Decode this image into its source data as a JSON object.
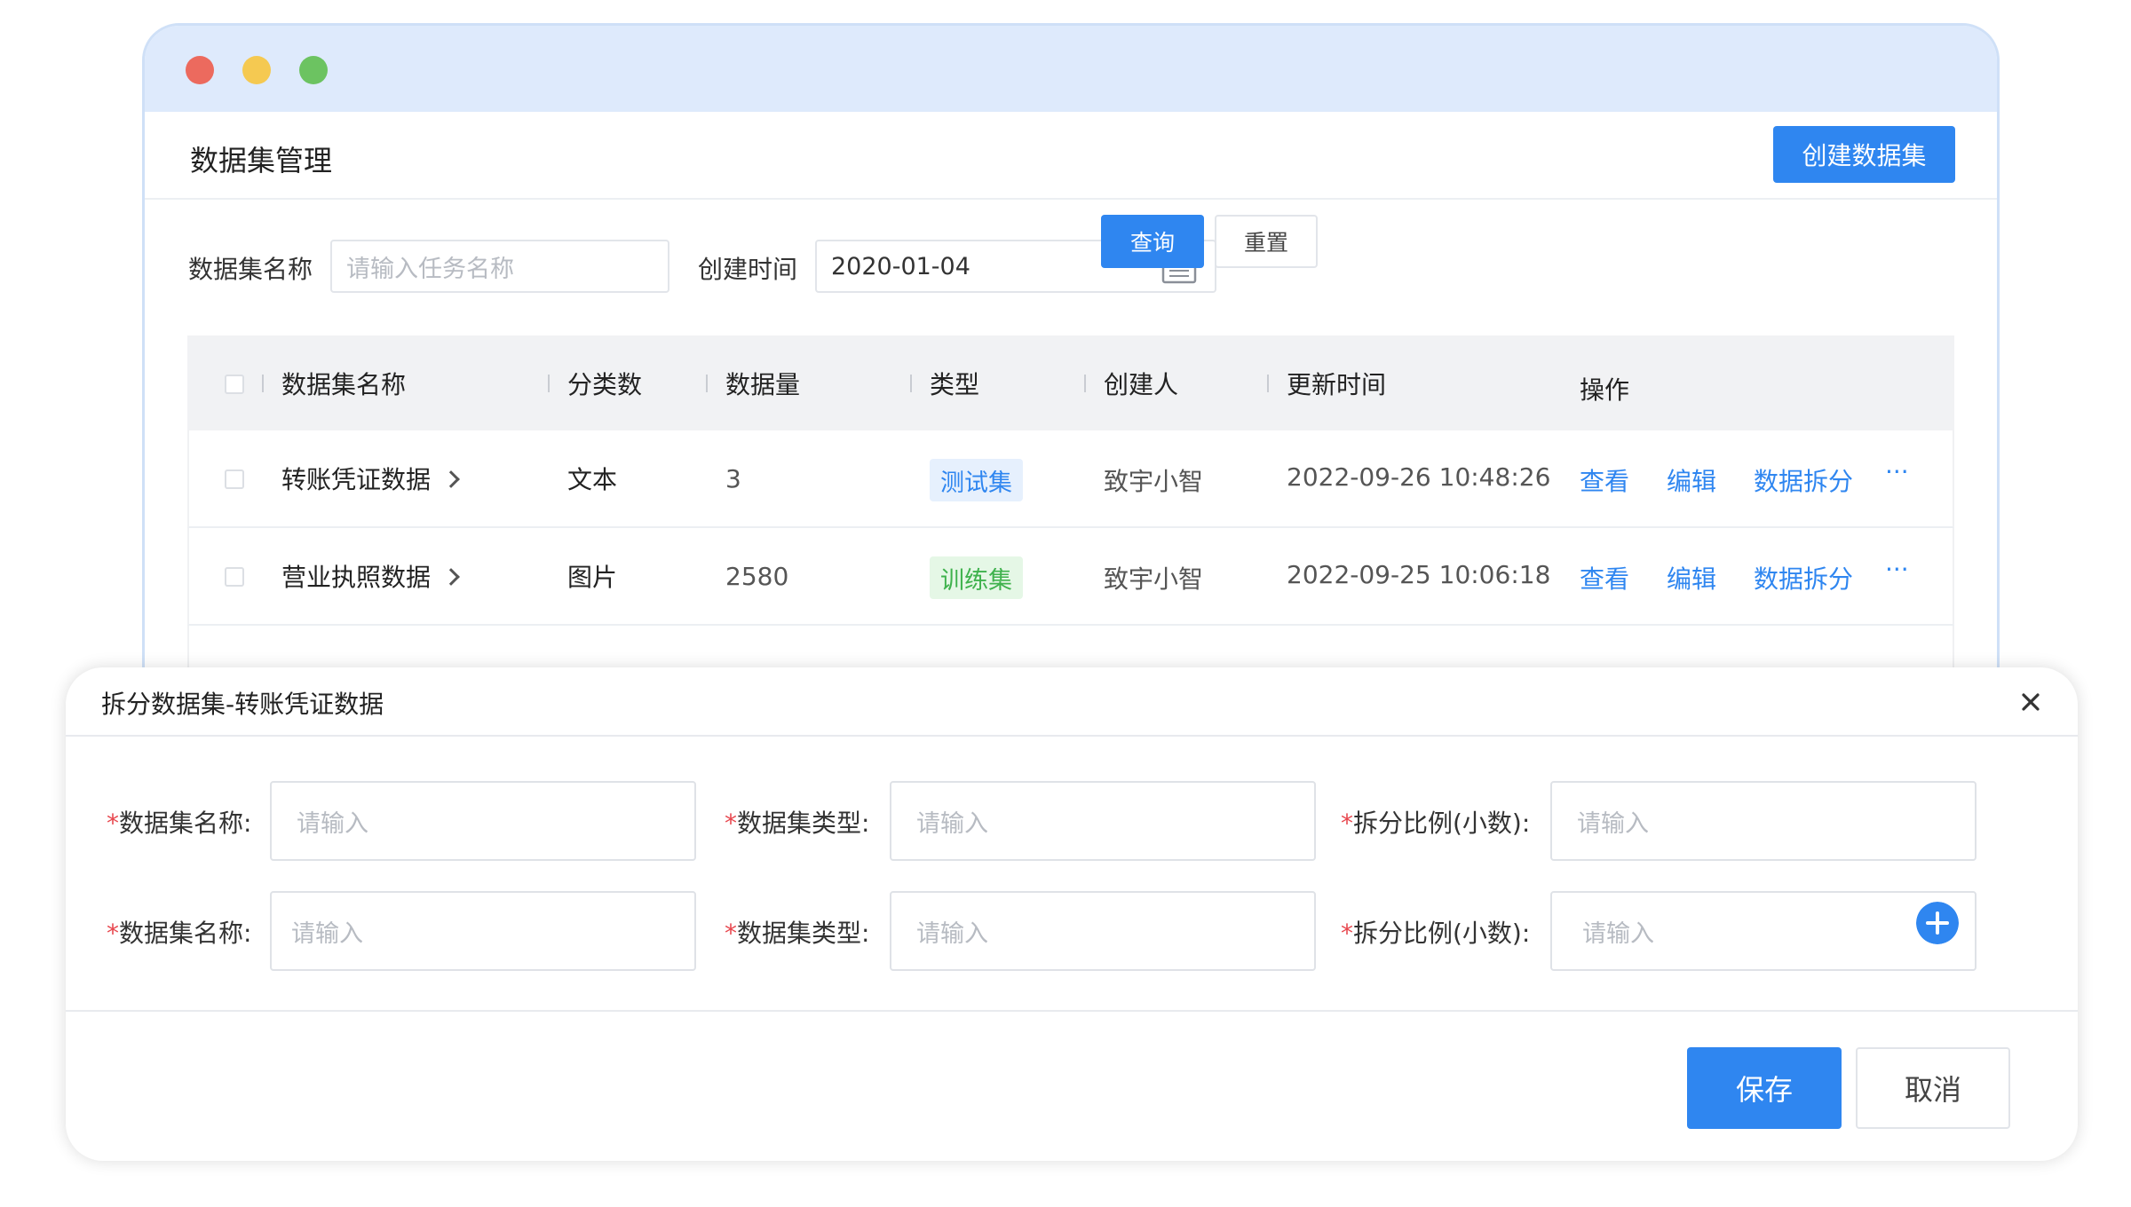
{
  "page": {
    "title": "数据集管理",
    "create_button": "创建数据集"
  },
  "filters": {
    "name_label": "数据集名称",
    "name_placeholder": "请输入任务名称",
    "time_label": "创建时间",
    "time_value": "2020-01-04",
    "query_button": "查询",
    "reset_button": "重置"
  },
  "table": {
    "columns": [
      "数据集名称",
      "分类数",
      "数据量",
      "类型",
      "创建人",
      "更新时间",
      "操作"
    ],
    "rows": [
      {
        "name": "转账凭证数据",
        "category": "文本",
        "count": "3",
        "type": "测试集",
        "type_style": "test",
        "creator": "致宇小智",
        "updated": "2022-09-26  10:48:26"
      },
      {
        "name": "营业执照数据",
        "category": "图片",
        "count": "2580",
        "type": "训练集",
        "type_style": "train",
        "creator": "致宇小智",
        "updated": "2022-09-25  10:06:18"
      }
    ],
    "actions": {
      "view": "查看",
      "edit": "编辑",
      "split": "数据拆分",
      "more": "···"
    }
  },
  "modal": {
    "title": "拆分数据集-转账凭证数据",
    "required_mark": "*",
    "label_name": "数据集名称:",
    "label_type": "数据集类型:",
    "label_ratio": "拆分比例(小数):",
    "placeholder": "请输入",
    "save_button": "保存",
    "cancel_button": "取消"
  },
  "colors": {
    "primary": "#2f86f0",
    "titlebar": "#deeafc",
    "traffic_red": "#ec6a5e",
    "traffic_yellow": "#f5c951",
    "traffic_green": "#6cc361",
    "required": "#e8484f"
  }
}
